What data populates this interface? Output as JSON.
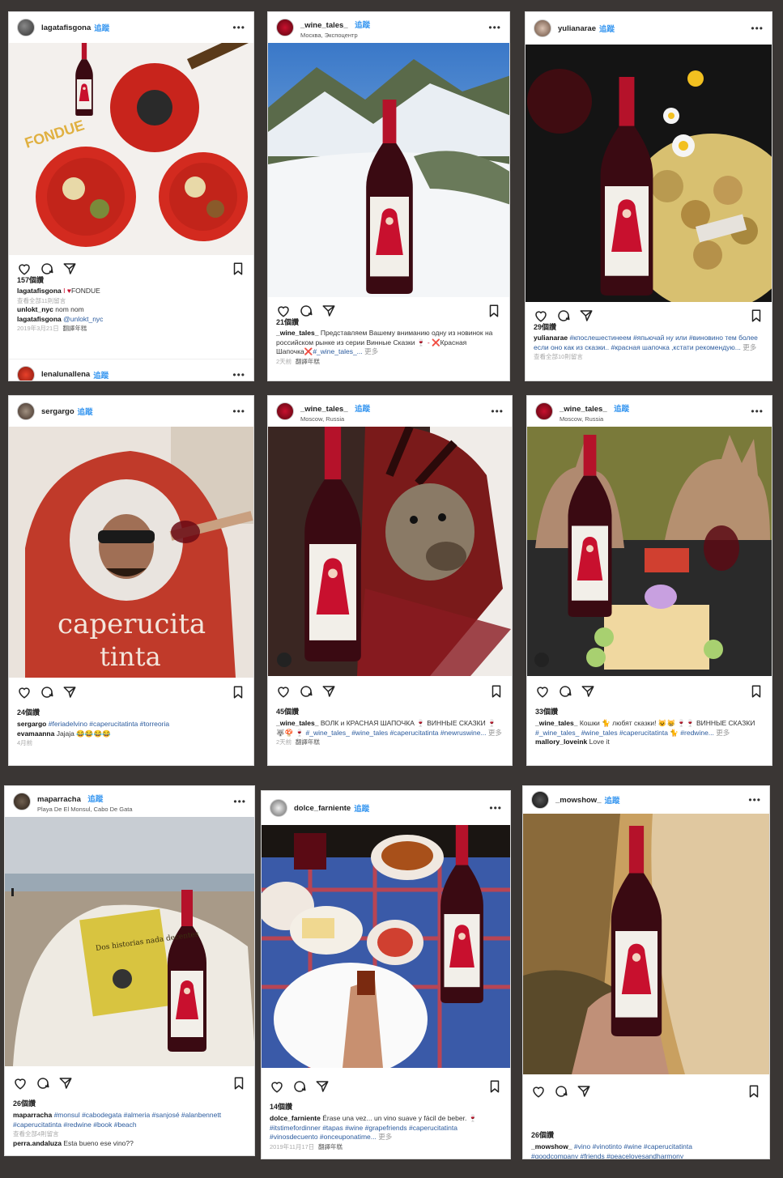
{
  "posts": [
    {
      "user": "lagatafisgona",
      "follow": "追蹤",
      "likes": "157個讚",
      "caption1_user": "lagatafisgona",
      "caption1_text": "FONDUE",
      "view_all": "查看全部11則留言",
      "comment1_user": "unlokt_nyc",
      "comment1_text": "nom nom",
      "comment2_user": "lagatafisgona",
      "comment2_text": "@unlokt_nyc",
      "date": "2019年3月21日",
      "translate": "翻譯年糕",
      "next_user": "lenalunallena",
      "next_follow": "追蹤",
      "photo_text": "FONDUE"
    },
    {
      "user": "_wine_tales_",
      "follow": "追蹤",
      "location": "Москва, Экспоцентр",
      "likes": "21個讚",
      "caption_user": "_wine_tales_",
      "caption_text": "Представляем Вашему вниманию одну из новинок на российском рынке из серии Винные Сказки",
      "caption_text2": "Красная Шапочка",
      "caption_tag": "#_wine_tales_...",
      "more": "更多",
      "date": "2天前",
      "translate": "翻譯年糕"
    },
    {
      "user": "yulianarae",
      "follow": "追蹤",
      "likes": "29個讚",
      "caption_user": "yulianarae",
      "caption_text": "#кпослешестинеем #япьючай ну или #виновино тем более если оно как из сказки.. #красная шапочка ,кстати рекомендую...",
      "more": "更多",
      "view_all": "查看全部10則留言"
    },
    {
      "user": "sergargo",
      "follow": "追蹤",
      "likes": "24個讚",
      "caption_user": "sergargo",
      "caption_text": "#feriadelvino #caperucitatinta #torreoria",
      "comment_user": "evamaanna",
      "comment_text": "Jajaja",
      "date": "4月前",
      "photo_text1": "caperucita",
      "photo_text2": "tinta"
    },
    {
      "user": "_wine_tales_",
      "follow": "追蹤",
      "location": "Moscow, Russia",
      "likes": "45個讚",
      "caption_user": "_wine_tales_",
      "caption_text": "ВОЛК и КРАСНАЯ ШАПОЧКА",
      "caption_text2": "ВИННЫЕ СКАЗКИ",
      "caption_tag": "#_wine_tales_ #wine_tales #caperucitatinta #newruswine...",
      "more": "更多",
      "date": "2天前",
      "translate": "翻譯年糕"
    },
    {
      "user": "_wine_tales_",
      "follow": "追蹤",
      "location": "Moscow, Russia",
      "likes": "33個讚",
      "caption_user": "_wine_tales_",
      "caption_text": "Кошки",
      "caption_text2": "любят сказки!",
      "caption_text3": "ВИННЫЕ СКАЗКИ",
      "caption_tag": "#_wine_tales_ #wine_tales #caperucitatinta",
      "caption_tag2": "#redwine...",
      "more": "更多",
      "comment_user": "mallory_loveink",
      "comment_text": "Love it"
    },
    {
      "user": "maparracha",
      "follow": "追蹤",
      "location": "Playa De El Monsul, Cabo De Gata",
      "likes": "26個讚",
      "caption_user": "maparracha",
      "caption_text": "#monsul #cabodegata #almeria #sanjosé #alanbennett #caperucitatinta #redwine #book #beach",
      "view_all": "查看全部4則留言",
      "comment_user": "perra.andaluza",
      "comment_text": "Esta bueno ese vino??",
      "book_text": "Dos historias nada decentes"
    },
    {
      "user": "dolce_farniente",
      "follow": "追蹤",
      "likes": "14個讚",
      "caption_user": "dolce_farniente",
      "caption_text": "Érase una vez... un vino suave y fácil de beber.",
      "caption_tag": "#itstimefordinner #tapas #wine #grapefriends #caperucitatinta #vinosdecuento #onceuponatime...",
      "more": "更多",
      "date": "2019年11月17日",
      "translate": "翻譯年糕"
    },
    {
      "user": "_mowshow_",
      "follow": "追蹤",
      "likes": "26個讚",
      "caption_user": "_mowshow_",
      "caption_text": "#vino #vinotinto #wine #caperucitatinta",
      "caption_tag2": "#goodcompany #friends #peacelovesandharmony"
    }
  ],
  "label_brand": "caperucita",
  "label_sub": "tinta",
  "colors": {
    "brand_red": "#c8102e",
    "link_blue": "#3897f0",
    "hashtag": "#2b5b9e"
  },
  "icons": [
    "heart-icon",
    "comment-icon",
    "share-icon",
    "bookmark-icon",
    "more-icon"
  ]
}
